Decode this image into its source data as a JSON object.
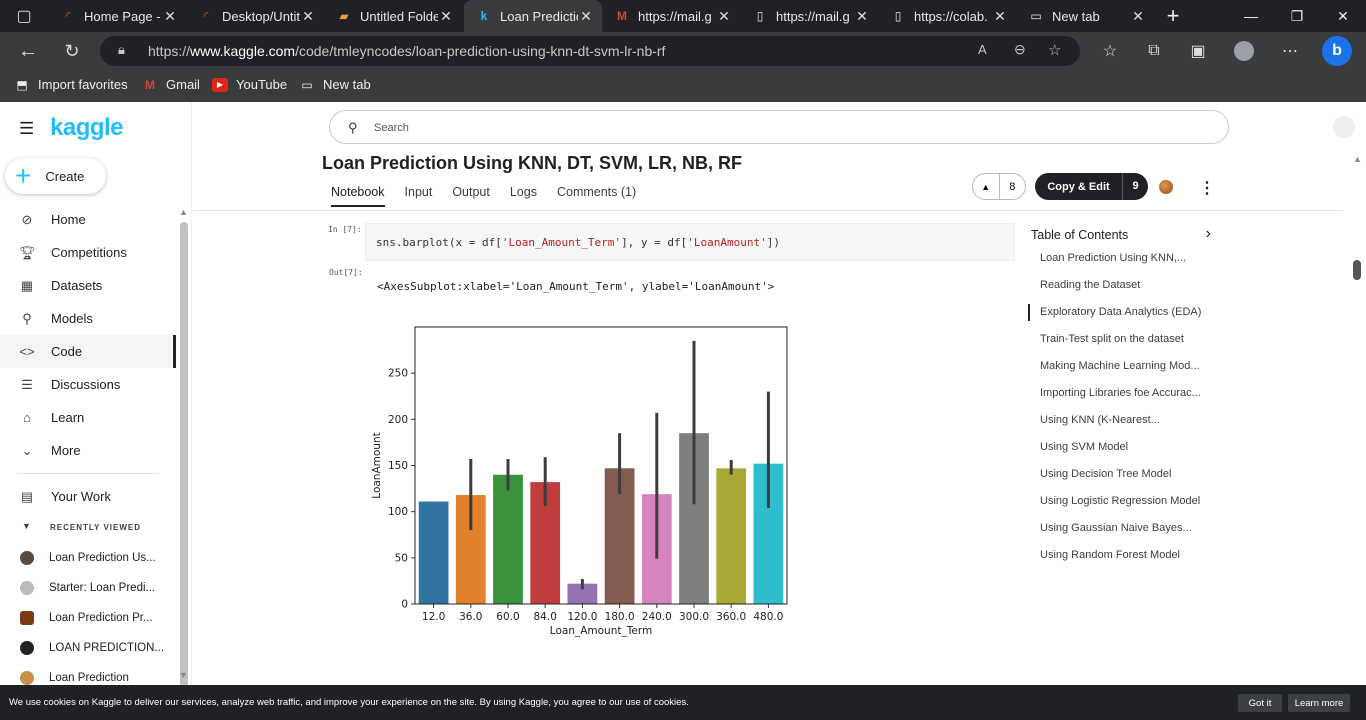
{
  "browser": {
    "tabs": [
      {
        "label": "Home Page -",
        "icon": "spinner-icon"
      },
      {
        "label": "Desktop/Untit",
        "icon": "spinner-icon"
      },
      {
        "label": "Untitled Folde",
        "icon": "file-icon"
      },
      {
        "label": "Loan Predictic",
        "icon": "kaggle-icon",
        "active": true
      },
      {
        "label": "https://mail.g",
        "icon": "gmail-icon"
      },
      {
        "label": "https://mail.g",
        "icon": "page-icon"
      },
      {
        "label": "https://colab.",
        "icon": "page-icon"
      },
      {
        "label": "New tab",
        "icon": "newtab-icon"
      }
    ],
    "url_prefix": "https://",
    "url_domain": "www.kaggle.com",
    "url_path": "/code/tmleyncodes/loan-prediction-using-knn-dt-svm-lr-nb-rf",
    "favorites": [
      {
        "label": "Import favorites"
      },
      {
        "label": "Gmail"
      },
      {
        "label": "YouTube"
      },
      {
        "label": "New tab"
      }
    ]
  },
  "sidebar": {
    "logo": "kaggle",
    "create_label": "Create",
    "items": [
      {
        "label": "Home",
        "icon": "compass-icon"
      },
      {
        "label": "Competitions",
        "icon": "trophy-icon"
      },
      {
        "label": "Datasets",
        "icon": "table-icon"
      },
      {
        "label": "Models",
        "icon": "models-icon"
      },
      {
        "label": "Code",
        "icon": "code-icon",
        "active": true
      },
      {
        "label": "Discussions",
        "icon": "discussion-icon"
      },
      {
        "label": "Learn",
        "icon": "learn-icon"
      },
      {
        "label": "More",
        "icon": "chevron-down-icon"
      }
    ],
    "your_work": "Your Work",
    "recently_viewed_label": "RECENTLY VIEWED",
    "recent": [
      {
        "label": "Loan Prediction Us..."
      },
      {
        "label": "Starter: Loan Predi..."
      },
      {
        "label": "Loan Prediction Pr..."
      },
      {
        "label": "LOAN PREDICTION..."
      },
      {
        "label": "Loan Prediction"
      }
    ]
  },
  "search": {
    "placeholder": "Search"
  },
  "notebook": {
    "title": "Loan Prediction Using KNN, DT, SVM, LR, NB, RF",
    "tabs": [
      "Notebook",
      "Input",
      "Output",
      "Logs",
      "Comments (1)"
    ],
    "votes": "8",
    "copy_edit_label": "Copy & Edit",
    "copy_edit_count": "9",
    "in_prompt": "In [7]:",
    "out_prompt": "Out[7]:",
    "code_prefix": "sns.barplot(x = df[",
    "code_str1": "'Loan_Amount_Term'",
    "code_mid": "], y = df[",
    "code_str2": "'LoanAmount'",
    "code_suffix": "])",
    "output_text": "<AxesSubplot:xlabel='Loan_Amount_Term', ylabel='LoanAmount'>"
  },
  "toc": {
    "title": "Table of Contents",
    "items": [
      "Loan Prediction Using KNN,...",
      "Reading the Dataset",
      "Exploratory Data Analytics (EDA)",
      "Train-Test split on the dataset",
      "Making Machine Learning Mod...",
      "Importing Libraries foe Accurac...",
      "Using KNN (K-Nearest...",
      "Using SVM Model",
      "Using Decision Tree Model",
      "Using Logistic Regression Model",
      "Using Gaussian Naive Bayes...",
      "Using Random Forest Model"
    ],
    "active_index": 2
  },
  "cookie": {
    "text": "We use cookies on Kaggle to deliver our services, analyze web traffic, and improve your experience on the site. By using Kaggle, you agree to our use of cookies.",
    "got_it": "Got it",
    "learn_more": "Learn more"
  },
  "chart_data": {
    "type": "bar",
    "xlabel": "Loan_Amount_Term",
    "ylabel": "LoanAmount",
    "categories": [
      "12.0",
      "36.0",
      "60.0",
      "84.0",
      "120.0",
      "180.0",
      "240.0",
      "300.0",
      "360.0",
      "480.0"
    ],
    "values": [
      111,
      118,
      140,
      132,
      22,
      147,
      119,
      185,
      147,
      152
    ],
    "ci_low": [
      111,
      80,
      123,
      106,
      16,
      119,
      49,
      108,
      140,
      104
    ],
    "ci_high": [
      111,
      157,
      157,
      159,
      27,
      185,
      207,
      285,
      156,
      230
    ],
    "colors": [
      "#3274a1",
      "#e1812c",
      "#3a923a",
      "#c03d3e",
      "#9372b2",
      "#845b53",
      "#d684bd",
      "#7f7f7f",
      "#a9aa35",
      "#2ebdcc"
    ],
    "yticks": [
      0,
      50,
      100,
      150,
      200,
      250
    ],
    "ylim": [
      0,
      300
    ]
  }
}
